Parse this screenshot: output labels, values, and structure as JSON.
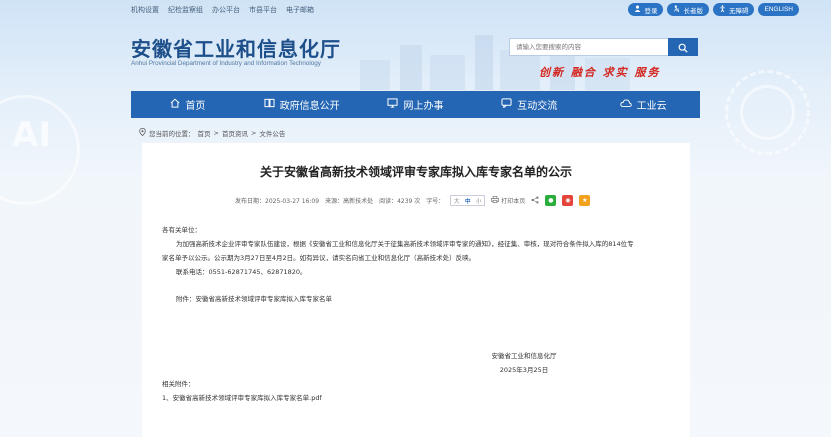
{
  "topbar": {
    "links": [
      "机构设置",
      "纪检监察组",
      "办公平台",
      "市县平台",
      "电子邮箱"
    ],
    "buttons": [
      {
        "label": "登录",
        "icon": "user-icon"
      },
      {
        "label": "长者版",
        "icon": "elder-icon"
      },
      {
        "label": "无障碍",
        "icon": "accessibility-icon"
      },
      {
        "label": "ENGLISH",
        "icon": ""
      }
    ]
  },
  "header": {
    "title": "安徽省工业和信息化厅",
    "subtitle": "Anhui Provincial Department of Industry and Information Technology",
    "slogan": "创新 融合 求实 服务"
  },
  "search": {
    "placeholder": "请输入您要搜索的内容"
  },
  "nav": {
    "items": [
      {
        "label": "首页",
        "icon": "home-icon"
      },
      {
        "label": "政府信息公开",
        "icon": "book-icon"
      },
      {
        "label": "网上办事",
        "icon": "monitor-icon"
      },
      {
        "label": "互动交流",
        "icon": "chat-icon"
      },
      {
        "label": "工业云",
        "icon": "cloud-icon"
      }
    ]
  },
  "breadcrumb": {
    "prefix": "您当前的位置：",
    "items": [
      "首页",
      "首页资讯",
      "文件公告"
    ],
    "separator": ">"
  },
  "article": {
    "title": "关于安徽省高新技术领域评审专家库拟入库专家名单的公示",
    "meta": {
      "date": "发布日期：2025-03-27 16:09",
      "source": "来源：高新技术处",
      "views": "阅读：4239 次",
      "font_label": "字号：",
      "sizes": [
        "大",
        "中",
        "小"
      ],
      "print": "打印本页"
    },
    "salutation": "各有关单位：",
    "paragraph1": "为加强高新技术企业评审专家队伍建设，根据《安徽省工业和信息化厅关于征集高新技术领域评审专家的通知》，经征集、审核，现对符合条件拟入库的814位专",
    "paragraph1b": "家名单予以公示。公示期为3月27日至4月2日。如有异议，请实名向省工业和信息化厅（高新技术处）反映。",
    "contact": "联系电话：0551-62871745、62871820。",
    "attachment": "附件：安徽省高新技术领域评审专家库拟入库专家名单",
    "sign_org": "安徽省工业和信息化厅",
    "sign_date": "2025年3月25日",
    "related_label": "相关附件：",
    "related_file": "1、安徽省高新技术领域评审专家库拟入库专家名单.pdf"
  },
  "deco": {
    "ai": "AI"
  },
  "colors": {
    "primary": "#2466b3",
    "slogan": "#d3261f"
  }
}
